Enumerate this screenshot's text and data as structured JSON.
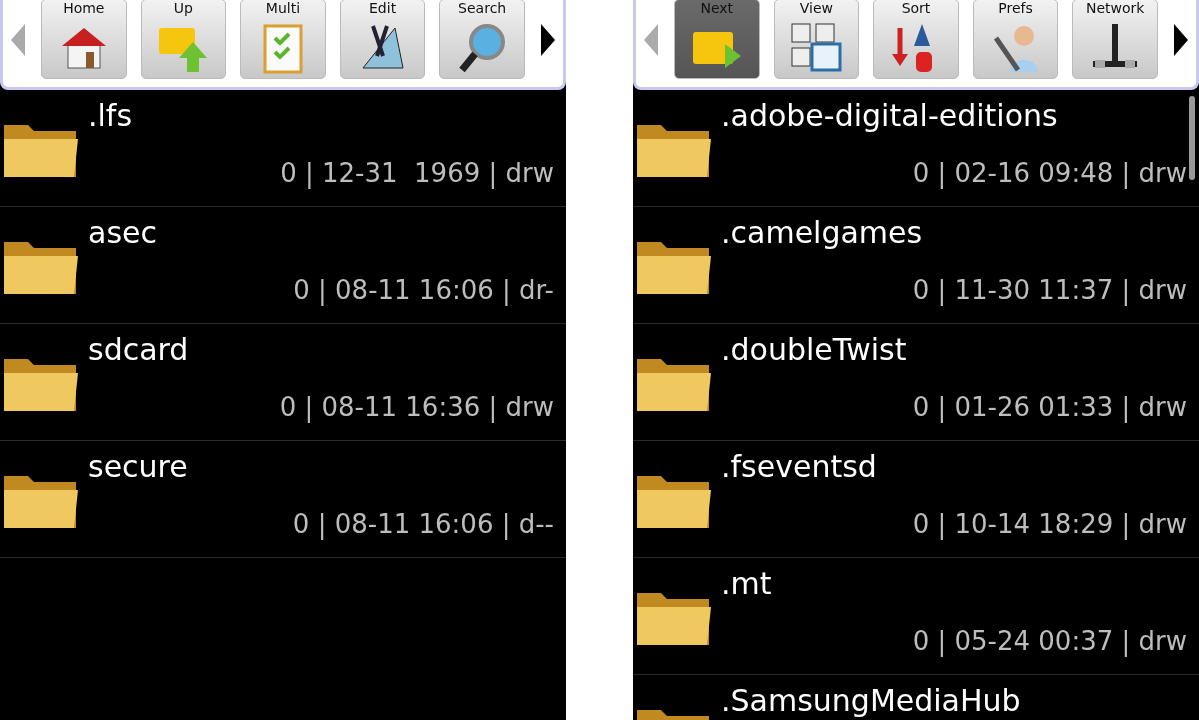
{
  "panels": [
    {
      "tools": [
        {
          "label": "Home",
          "kind": "home",
          "selected": false
        },
        {
          "label": "Up",
          "kind": "up",
          "selected": false
        },
        {
          "label": "Multi",
          "kind": "multi",
          "selected": false
        },
        {
          "label": "Edit",
          "kind": "edit",
          "selected": false
        },
        {
          "label": "Search",
          "kind": "search",
          "selected": false
        }
      ],
      "scrollbar": false,
      "files": [
        {
          "name": ".lfs",
          "meta": "0 | 12-31  1969 | drw"
        },
        {
          "name": "asec",
          "meta": "0 | 08-11 16:06 | dr-"
        },
        {
          "name": "sdcard",
          "meta": "0 | 08-11 16:36 | drw"
        },
        {
          "name": "secure",
          "meta": "0 | 08-11 16:06 | d--"
        }
      ]
    },
    {
      "tools": [
        {
          "label": "Next",
          "kind": "next",
          "selected": true
        },
        {
          "label": "View",
          "kind": "view",
          "selected": false
        },
        {
          "label": "Sort",
          "kind": "sort",
          "selected": false
        },
        {
          "label": "Prefs",
          "kind": "prefs",
          "selected": false
        },
        {
          "label": "Network",
          "kind": "network",
          "selected": false
        }
      ],
      "scrollbar": true,
      "files": [
        {
          "name": ".adobe-digital-editions",
          "meta": "0 | 02-16 09:48 | drw"
        },
        {
          "name": ".camelgames",
          "meta": "0 | 11-30 11:37 | drw"
        },
        {
          "name": ".doubleTwist",
          "meta": "0 | 01-26 01:33 | drw"
        },
        {
          "name": ".fseventsd",
          "meta": "0 | 10-14 18:29 | drw"
        },
        {
          "name": ".mt",
          "meta": "0 | 05-24 00:37 | drw"
        },
        {
          "name": ".SamsungMediaHub"
        }
      ]
    }
  ]
}
